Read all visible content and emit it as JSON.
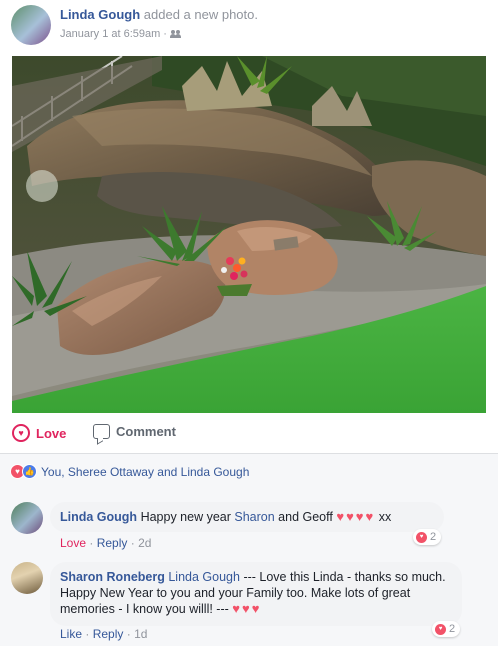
{
  "post": {
    "author": "Linda Gough",
    "action": "added a new photo.",
    "timestamp": "January 1 at 6:59am",
    "separator": "·",
    "privacy_icon": "friends-icon"
  },
  "actions": {
    "love_label": "Love",
    "comment_label": "Comment"
  },
  "reactions": {
    "icons": [
      "love-icon",
      "like-icon"
    ],
    "text": "You, Sheree Ottaway and Linda Gough"
  },
  "comments": [
    {
      "author": "Linda Gough",
      "text_1": "Happy new year",
      "tag": "Sharon",
      "text_2": "and Geoff",
      "hearts": "♥♥♥♥",
      "suffix": "xx",
      "reaction_count": "2",
      "reaction_label": "Love",
      "reply_label": "Reply",
      "time": "2d"
    },
    {
      "author": "Sharon Roneberg",
      "tag": "Linda Gough",
      "text": "--- Love this Linda - thanks so much. Happy New Year to you and your Family too. Make lots of great memories - I know you willl! ---",
      "hearts": "♥♥♥",
      "reaction_count": "2",
      "like_label": "Like",
      "reply_label": "Reply",
      "time": "1d"
    }
  ],
  "colors": {
    "link": "#365899",
    "love": "#e0245e",
    "meta": "#90949c",
    "lawn": "#3fae3a"
  }
}
